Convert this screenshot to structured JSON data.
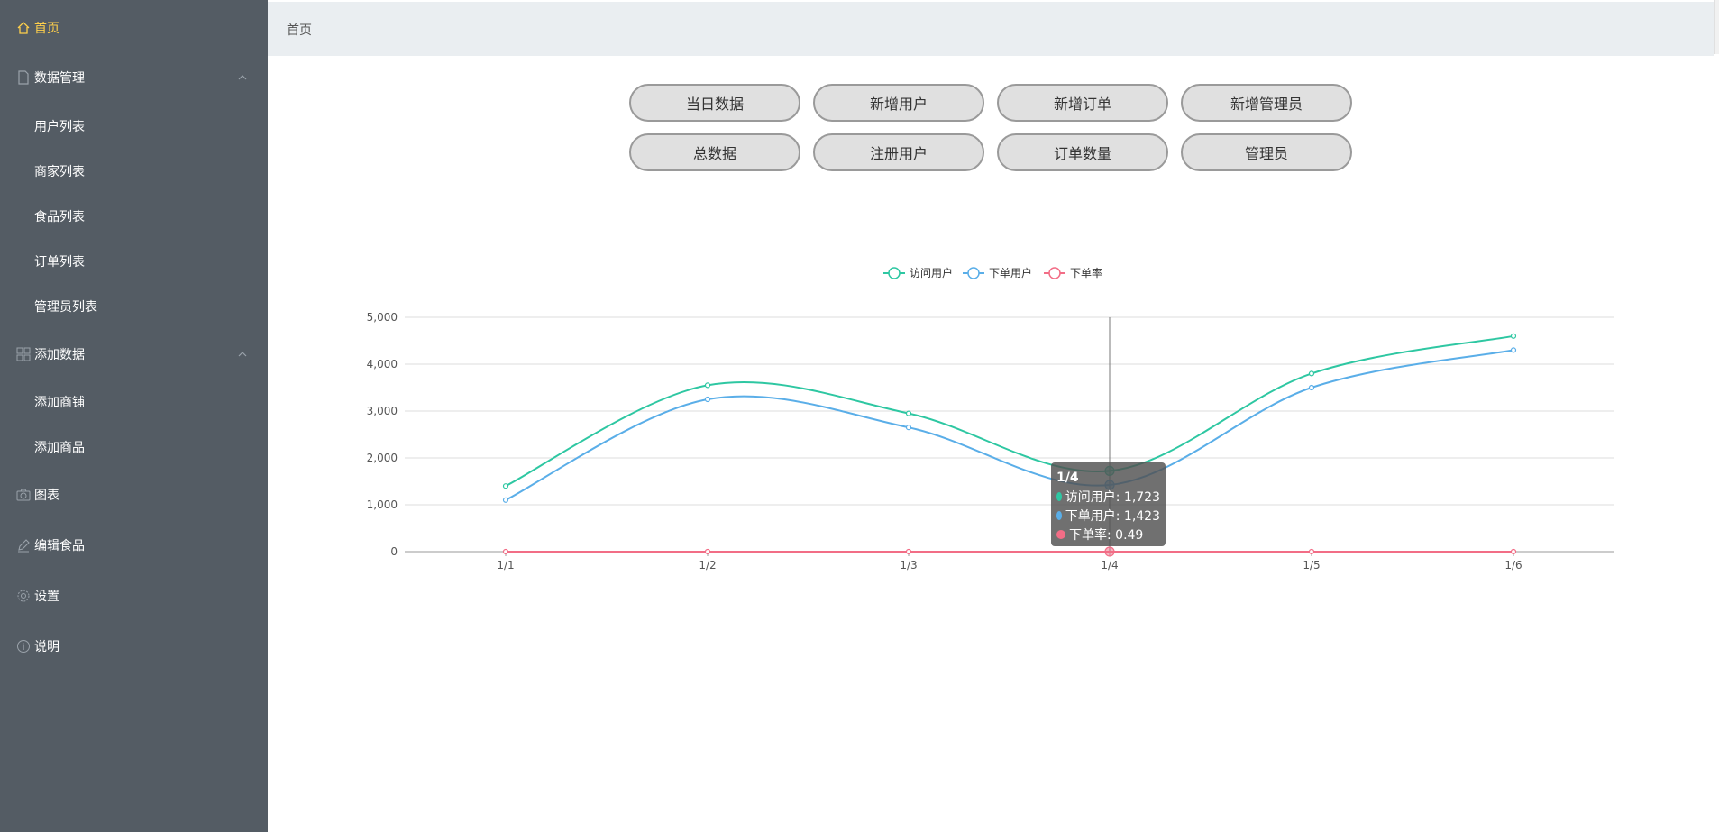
{
  "sidebar": {
    "items": [
      {
        "label": "首页",
        "icon": "home-icon",
        "active": true
      },
      {
        "label": "数据管理",
        "icon": "document-icon",
        "expanded": true,
        "children": [
          "用户列表",
          "商家列表",
          "食品列表",
          "订单列表",
          "管理员列表"
        ]
      },
      {
        "label": "添加数据",
        "icon": "grid-icon",
        "expanded": true,
        "children": [
          "添加商铺",
          "添加商品"
        ]
      },
      {
        "label": "图表",
        "icon": "camera-icon"
      },
      {
        "label": "编辑食品",
        "icon": "edit-icon"
      },
      {
        "label": "设置",
        "icon": "gear-icon"
      },
      {
        "label": "说明",
        "icon": "info-icon"
      }
    ],
    "active_color": "#ffd04b",
    "bg_color": "#545c64"
  },
  "header": {
    "breadcrumb": "首页"
  },
  "buttons": {
    "row1": [
      "当日数据",
      "新增用户",
      "新增订单",
      "新增管理员"
    ],
    "row2": [
      "总数据",
      "注册用户",
      "订单数量",
      "管理员"
    ]
  },
  "chart_data": {
    "type": "line",
    "smooth": true,
    "categories": [
      "1/1",
      "1/2",
      "1/3",
      "1/4",
      "1/5",
      "1/6"
    ],
    "series": [
      {
        "name": "访问用户",
        "color": "#2ec7a2",
        "values": [
          1400,
          3550,
          2950,
          1723,
          3800,
          4600
        ]
      },
      {
        "name": "下单用户",
        "color": "#5aaee8",
        "values": [
          1100,
          3250,
          2650,
          1423,
          3500,
          4300
        ]
      },
      {
        "name": "下单率",
        "color": "#f26d86",
        "values": [
          0.3,
          0.5,
          0.4,
          0.49,
          0.5,
          0.6
        ]
      }
    ],
    "y_ticks": [
      "0",
      "1,000",
      "2,000",
      "3,000",
      "4,000",
      "5,000"
    ],
    "ylim": [
      0,
      5000
    ],
    "grid": true,
    "legend": "top-center",
    "tooltip": {
      "title": "1/4",
      "rows": [
        "访问用户: 1,723",
        "下单用户: 1,423",
        "下单率: 0.49"
      ]
    }
  }
}
